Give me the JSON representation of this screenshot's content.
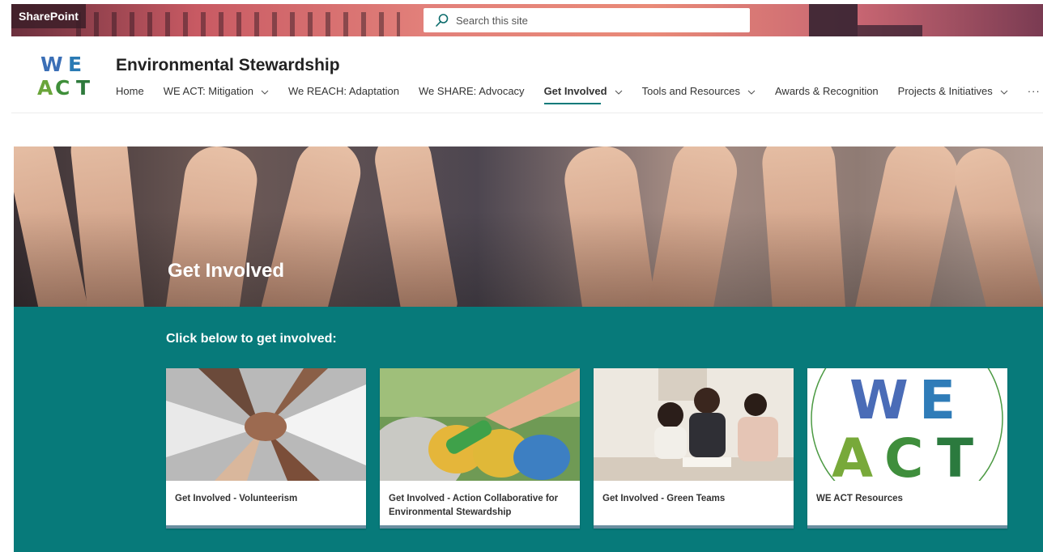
{
  "suite": {
    "brand": "SharePoint",
    "search_placeholder": "Search this site"
  },
  "site": {
    "logo_text": "WE ACT",
    "title": "Environmental Stewardship"
  },
  "nav": {
    "items": [
      {
        "label": "Home",
        "dropdown": false
      },
      {
        "label": "WE ACT: Mitigation",
        "dropdown": true
      },
      {
        "label": "We REACH: Adaptation",
        "dropdown": false
      },
      {
        "label": "We SHARE: Advocacy",
        "dropdown": false
      },
      {
        "label": "Get Involved",
        "dropdown": true,
        "active": true
      },
      {
        "label": "Tools and Resources",
        "dropdown": true
      },
      {
        "label": "Awards & Recognition",
        "dropdown": false
      },
      {
        "label": "Projects & Initiatives",
        "dropdown": true
      }
    ],
    "more": "···"
  },
  "hero": {
    "title": "Get Involved"
  },
  "section": {
    "heading": "Click below to get involved:",
    "background": "#077a7a",
    "cards": [
      {
        "label": "Get Involved - Volunteerism",
        "image": "hands-together-image"
      },
      {
        "label": "Get Involved - Action Collaborative for Environmental Stewardship",
        "image": "recycling-bottle-image"
      },
      {
        "label": "Get Involved - Green Teams",
        "image": "team-meeting-image"
      },
      {
        "label": "WE ACT Resources",
        "image": "we-act-logo-image"
      }
    ]
  },
  "colors": {
    "accent": "#077a7a",
    "card_strip": "#6a8ea0"
  }
}
